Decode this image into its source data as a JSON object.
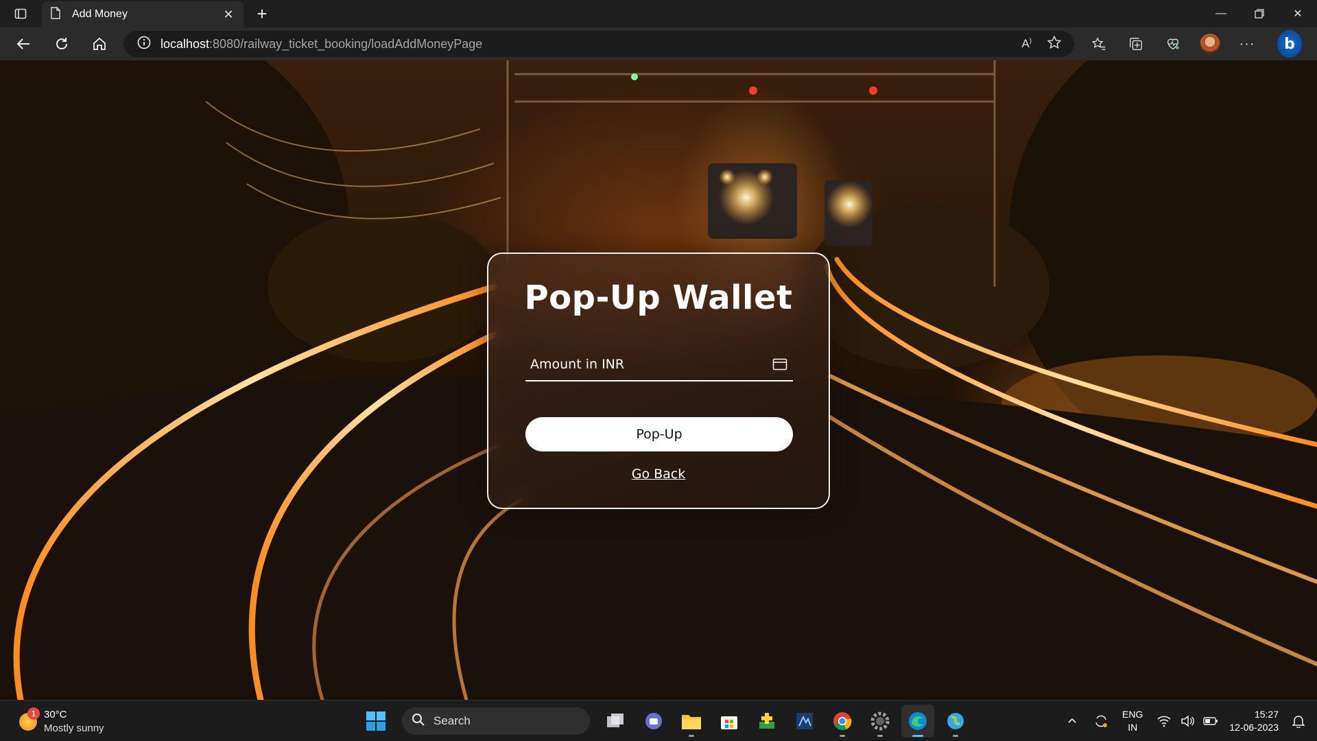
{
  "browser": {
    "tab": {
      "title": "Add Money"
    },
    "url": {
      "host": "localhost",
      "rest": ":8080/railway_ticket_booking/loadAddMoneyPage"
    }
  },
  "page": {
    "title": "Pop-Up Wallet",
    "amount_placeholder": "Amount in INR",
    "popup_button": "Pop-Up",
    "go_back_link": "Go Back"
  },
  "taskbar": {
    "weather": {
      "temp": "30°C",
      "condition": "Mostly sunny",
      "badge": "1"
    },
    "search_label": "Search",
    "language": {
      "line1": "ENG",
      "line2": "IN"
    },
    "clock": {
      "time": "15:27",
      "date": "12-06-2023"
    },
    "apps": [
      "task-view",
      "teams-chat",
      "file-explorer",
      "microsoft-store",
      "game-app",
      "dev-tool",
      "chrome",
      "settings",
      "edge",
      "maps-app"
    ]
  },
  "colors": {
    "accent": "#4cc2ff",
    "card_border": "#ffffff",
    "rail_glow": "#ffb347"
  }
}
